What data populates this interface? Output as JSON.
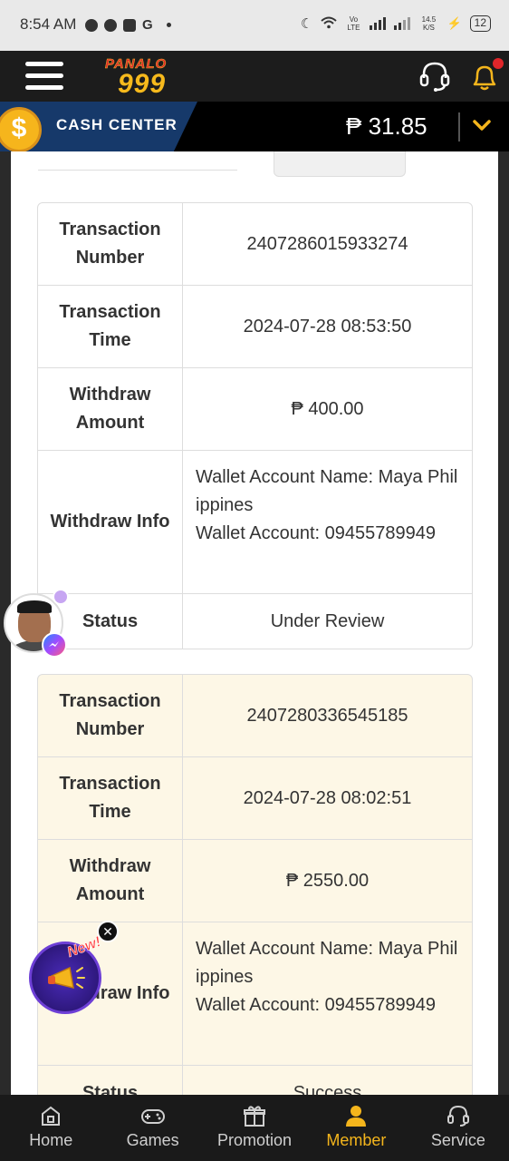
{
  "status_bar": {
    "time": "8:54 AM",
    "g_label": "G",
    "vo_lte": "Vo LTE",
    "speed": "14.5 K/S",
    "battery": "12"
  },
  "header": {
    "logo_top": "PANALO",
    "logo_number": "999"
  },
  "cash_center": {
    "label": "CASH CENTER",
    "balance": "₱ 31.85"
  },
  "records": [
    {
      "transaction_number_label": "Transaction Number",
      "transaction_number": "2407286015933274",
      "transaction_time_label": "Transaction Time",
      "transaction_time": "2024-07-28 08:53:50",
      "amount_label": "Withdraw Amount",
      "amount": "₱ 400.00",
      "info_label": "Withdraw Info",
      "wallet_name_line": "Wallet Account Name: Maya Philippines",
      "wallet_account_line": "Wallet Account: 09455789949",
      "status_label": "Status",
      "status": "Under Review"
    },
    {
      "transaction_number_label": "Transaction Number",
      "transaction_number": "2407280336545185",
      "transaction_time_label": "Transaction Time",
      "transaction_time": "2024-07-28 08:02:51",
      "amount_label": "Withdraw Amount",
      "amount": "₱ 2550.00",
      "info_label": "Withdraw Info",
      "wallet_name_line": "Wallet Account Name: Maya Philippines",
      "wallet_account_line": "Wallet Account: 09455789949",
      "status_label": "Status",
      "status": "Success"
    }
  ],
  "promo": {
    "badge": "New!",
    "close": "✕"
  },
  "bottom_nav": [
    {
      "label": "Home",
      "icon": "home-icon"
    },
    {
      "label": "Games",
      "icon": "gamepad-icon"
    },
    {
      "label": "Promotion",
      "icon": "gift-icon"
    },
    {
      "label": "Member",
      "icon": "member-icon",
      "active": true
    },
    {
      "label": "Service",
      "icon": "headset-icon"
    }
  ],
  "colors": {
    "accent": "#f4b51c",
    "cash_bar_blue": "#16396a",
    "record_cream": "#fdf7e6"
  }
}
